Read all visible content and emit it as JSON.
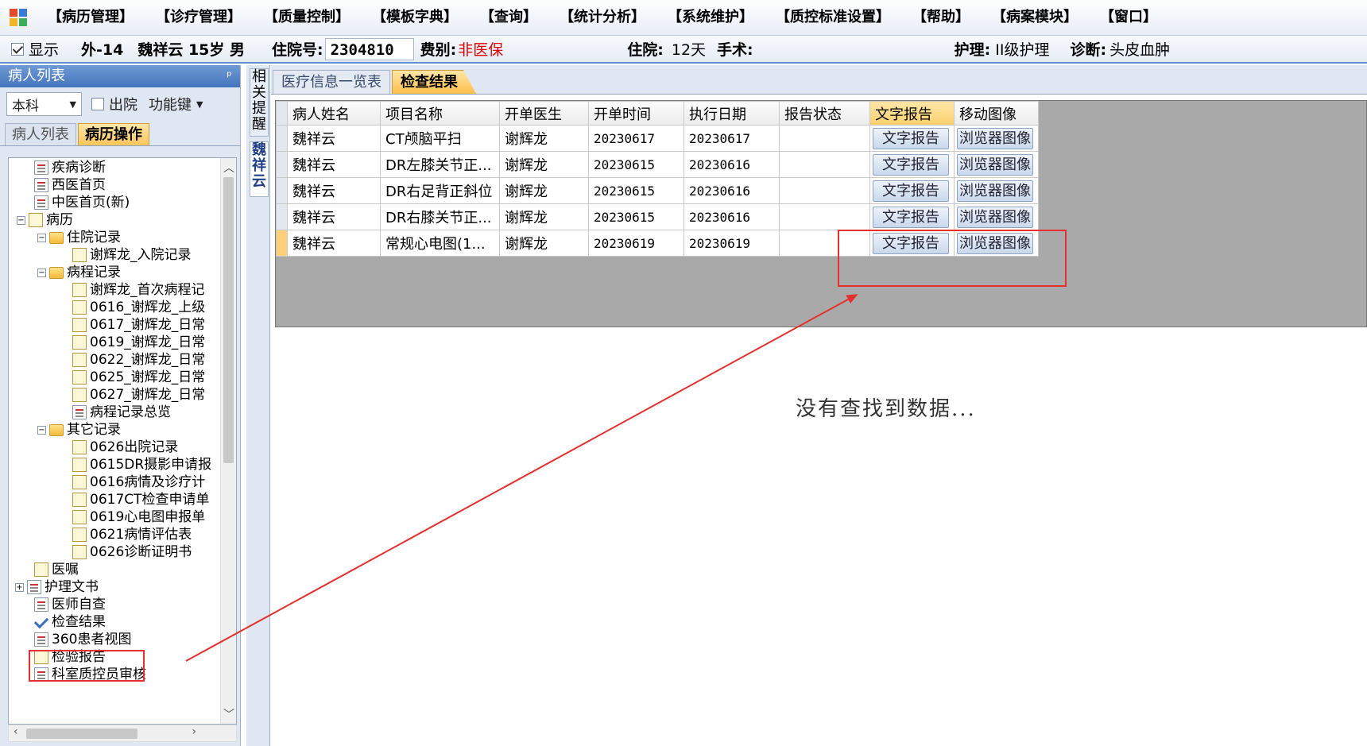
{
  "menu": {
    "items": [
      "【病历管理】",
      "【诊疗管理】",
      "【质量控制】",
      "【模板字典】",
      "【查询】",
      "【统计分析】",
      "【系统维护】",
      "【质控标准设置】",
      "【帮助】",
      "【病案模块】",
      "【窗口】"
    ]
  },
  "patient": {
    "show_label": "显示",
    "bed": "外-14",
    "name_age_sex": "魏祥云 15岁 男",
    "admission_no_label": "住院号:",
    "admission_no": "2304810",
    "fee_label": "费别:",
    "fee_value": "非医保",
    "stay_label": "住院:",
    "stay_value": "12天",
    "surgery_label": "手术:",
    "nursing_label": "护理:",
    "nursing_value": "II级护理",
    "diagnosis_label": "诊断:",
    "diagnosis_value": "头皮血肿"
  },
  "left_panel": {
    "title": "病人列表",
    "pin": "ᵖ",
    "dept_combo": "本科",
    "discharge_label": "出院",
    "function_key": "功能键",
    "tabs": [
      "病人列表",
      "病历操作"
    ],
    "tree": [
      {
        "label": "疾病诊断",
        "icon": "doc"
      },
      {
        "label": "西医首页",
        "icon": "doc"
      },
      {
        "label": "中医首页(新)",
        "icon": "doc"
      },
      {
        "label": "病历",
        "icon": "note",
        "expander": "−"
      },
      {
        "label": "住院记录",
        "icon": "folder",
        "expander": "−"
      },
      {
        "label": "谢辉龙_入院记录",
        "icon": "note"
      },
      {
        "label": "病程记录",
        "icon": "folder",
        "expander": "−"
      },
      {
        "label": "谢辉龙_首次病程记",
        "icon": "note"
      },
      {
        "label": "0616_谢辉龙_上级",
        "icon": "note"
      },
      {
        "label": "0617_谢辉龙_日常",
        "icon": "note"
      },
      {
        "label": "0619_谢辉龙_日常",
        "icon": "note"
      },
      {
        "label": "0622_谢辉龙_日常",
        "icon": "note"
      },
      {
        "label": "0625_谢辉龙_日常",
        "icon": "note"
      },
      {
        "label": "0627_谢辉龙_日常",
        "icon": "note"
      },
      {
        "label": "病程记录总览",
        "icon": "doc"
      },
      {
        "label": "其它记录",
        "icon": "folder",
        "expander": "−"
      },
      {
        "label": "0626出院记录",
        "icon": "note"
      },
      {
        "label": "0615DR摄影申请报",
        "icon": "note"
      },
      {
        "label": "0616病情及诊疗计",
        "icon": "note"
      },
      {
        "label": "0617CT检查申请单",
        "icon": "note"
      },
      {
        "label": "0619心电图申报单",
        "icon": "note"
      },
      {
        "label": "0621病情评估表",
        "icon": "note"
      },
      {
        "label": "0626诊断证明书",
        "icon": "note"
      },
      {
        "label": "医嘱",
        "icon": "note"
      },
      {
        "label": "护理文书",
        "icon": "doc",
        "expander": "+"
      },
      {
        "label": "医师自查",
        "icon": "doc"
      },
      {
        "label": "检查结果",
        "icon": "check"
      },
      {
        "label": "360患者视图",
        "icon": "doc"
      },
      {
        "label": "检验报告",
        "icon": "note"
      },
      {
        "label": "科室质控员审核",
        "icon": "doc"
      }
    ]
  },
  "side_tabs": {
    "related": "相关提醒",
    "patient": "魏祥云"
  },
  "main": {
    "tabs": [
      "医疗信息一览表",
      "检查结果"
    ],
    "columns": [
      "病人姓名",
      "项目名称",
      "开单医生",
      "开单时间",
      "执行日期",
      "报告状态",
      "文字报告",
      "移动图像"
    ],
    "rows": [
      {
        "name": "魏祥云",
        "item": "CT颅脑平扫",
        "doctor": "谢辉龙",
        "order_time": "20230617",
        "exec_date": "20230617",
        "status": "",
        "text_btn": "文字报告",
        "img_btn": "浏览器图像"
      },
      {
        "name": "魏祥云",
        "item": "DR左膝关节正...",
        "doctor": "谢辉龙",
        "order_time": "20230615",
        "exec_date": "20230616",
        "status": "",
        "text_btn": "文字报告",
        "img_btn": "浏览器图像"
      },
      {
        "name": "魏祥云",
        "item": "DR右足背正斜位",
        "doctor": "谢辉龙",
        "order_time": "20230615",
        "exec_date": "20230616",
        "status": "",
        "text_btn": "文字报告",
        "img_btn": "浏览器图像"
      },
      {
        "name": "魏祥云",
        "item": "DR右膝关节正...",
        "doctor": "谢辉龙",
        "order_time": "20230615",
        "exec_date": "20230616",
        "status": "",
        "text_btn": "文字报告",
        "img_btn": "浏览器图像"
      },
      {
        "name": "魏祥云",
        "item": "常规心电图(1...",
        "doctor": "谢辉龙",
        "order_time": "20230619",
        "exec_date": "20230619",
        "status": "",
        "text_btn": "文字报告",
        "img_btn": "浏览器图像"
      }
    ],
    "no_data": "没有查找到数据..."
  },
  "colors": {
    "annotation": "#e53030",
    "active_tab": "#ffc55a",
    "fee_red": "#e00000"
  }
}
